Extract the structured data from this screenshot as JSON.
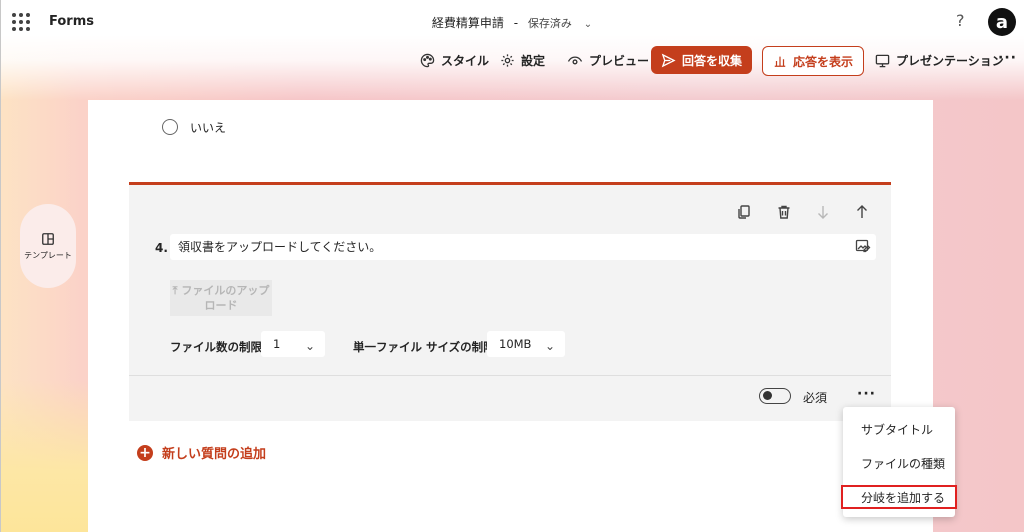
{
  "app": {
    "name": "Forms"
  },
  "form_title": {
    "title": "経費精算申請",
    "separator": "-",
    "status": "保存済み"
  },
  "toolbar": {
    "style": "スタイル",
    "settings": "設定",
    "preview": "プレビュー",
    "collect": "回答を収集",
    "show_responses": "応答を表示",
    "presentation": "プレゼンテーション",
    "more": "···"
  },
  "help": "?",
  "avatar_letter": "a",
  "sidebar": {
    "template_label": "テンプレート"
  },
  "prev_question": {
    "option_no": "いいえ"
  },
  "question": {
    "number": "4.",
    "text": "領収書をアップロードしてください。",
    "upload_button": "ファイルのアップロード",
    "file_limit_label": "ファイル数の制限:",
    "file_limit_value": "1",
    "size_limit_label": "単一ファイル サイズの制限:",
    "size_limit_value": "10MB",
    "required_label": "必須",
    "required_on": false,
    "more": "···"
  },
  "context_menu": {
    "items": [
      "サブタイトル",
      "ファイルの種類",
      "分岐を追加する"
    ],
    "highlighted_index": 2
  },
  "add_question": "新しい質問の追加",
  "colors": {
    "accent": "#c43e1c",
    "highlight_box": "#e02020"
  }
}
